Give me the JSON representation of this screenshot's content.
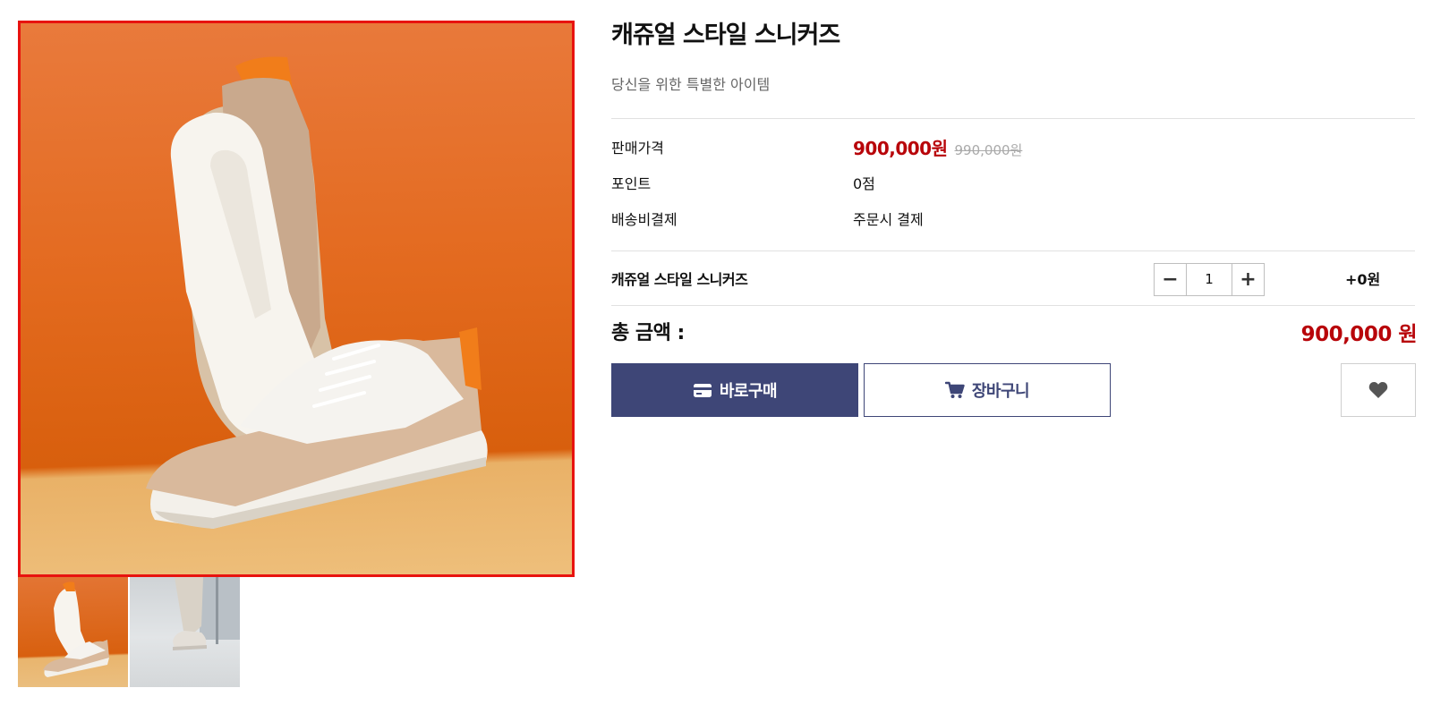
{
  "product": {
    "title": "캐쥬얼 스타일 스니커즈",
    "subtitle": "당신을 위한 특별한 아이템",
    "main_image": "sneakers-on-orange-background-photo",
    "thumbnails": [
      "sneakers-orange-thumbnail",
      "sneakers-worn-thumbnail"
    ]
  },
  "details": {
    "price_label": "판매가격",
    "price_now": "900,000원",
    "price_old": "990,000원",
    "point_label": "포인트",
    "point_value": "0점",
    "shipping_label": "배송비결제",
    "shipping_value": "주문시 결제"
  },
  "option": {
    "name": "캐쥬얼 스타일 스니커즈",
    "minus_label": "−",
    "quantity": "1",
    "plus_label": "+",
    "price": "+0원"
  },
  "total": {
    "label": "총 금액 :",
    "amount": "900,000 원"
  },
  "actions": {
    "buy_label": "바로구매",
    "cart_label": "장바구니",
    "buy_icon": "credit-card-icon",
    "cart_icon": "cart-icon",
    "wish_icon": "heart-icon"
  },
  "colors": {
    "accent": "#3e4677",
    "price": "#b8050a",
    "selected_border": "#e8130f"
  }
}
